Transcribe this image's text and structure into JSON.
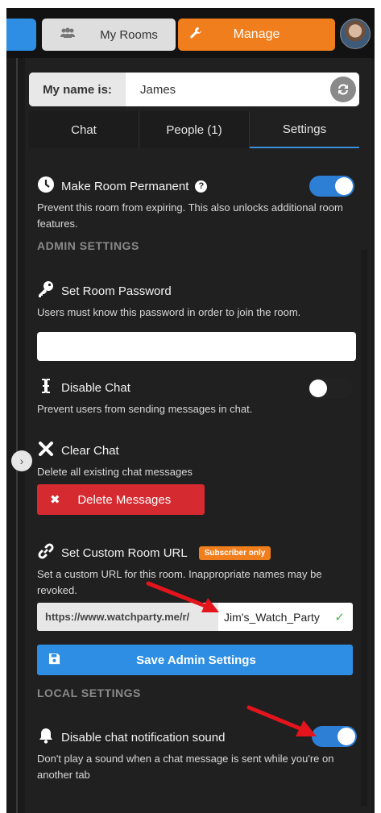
{
  "topbar": {
    "my_rooms_label": "My Rooms",
    "manage_label": "Manage",
    "accent_orange": "#f07e1d",
    "accent_blue": "#2d8ee3"
  },
  "name": {
    "label": "My name is:",
    "value": "James"
  },
  "tabs": [
    {
      "label": "Chat",
      "active": false
    },
    {
      "label": "People (1)",
      "active": false
    },
    {
      "label": "Settings",
      "active": true
    }
  ],
  "permanent": {
    "title": "Make Room Permanent",
    "help": "?",
    "desc": "Prevent this room from expiring. This also unlocks additional room features.",
    "enabled": true
  },
  "admin_heading": "ADMIN SETTINGS",
  "password": {
    "title": "Set Room Password",
    "desc": "Users must know this password in order to join the room.",
    "value": ""
  },
  "disable_chat": {
    "title": "Disable Chat",
    "desc": "Prevent users from sending messages in chat.",
    "enabled": false
  },
  "clear_chat": {
    "title": "Clear Chat",
    "desc": "Delete all existing chat messages",
    "button_label": "Delete Messages",
    "button_icon": "✖"
  },
  "custom_url": {
    "title": "Set Custom Room URL",
    "badge": "Subscriber only",
    "desc": "Set a custom URL for this room. Inappropriate names may be revoked.",
    "prefix": "https://www.watchparty.me/r/",
    "value": "Jim's_Watch_Party",
    "check": "✓"
  },
  "save_admin_label": "Save Admin Settings",
  "local_heading": "LOCAL SETTINGS",
  "notification": {
    "title": "Disable chat notification sound",
    "desc": "Don't play a sound when a chat message is sent while you're on another tab",
    "enabled": true
  },
  "collapse_glyph": "›",
  "colors": {
    "panel": "#202020",
    "delete_red": "#d42a30",
    "arrow_red": "#e3141c"
  }
}
